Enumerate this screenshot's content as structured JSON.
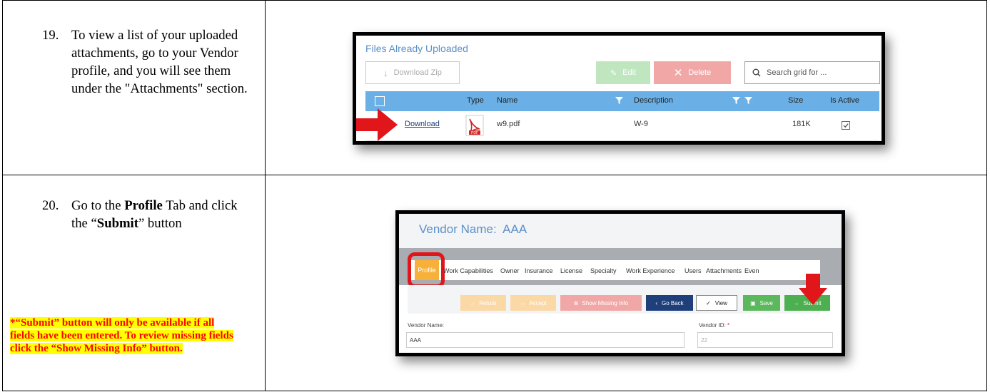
{
  "steps": [
    {
      "number": "19.",
      "text": "To view a list of your uploaded attachments, go to your Vendor profile, and you will see them under the \"Attachments\" section."
    },
    {
      "number": "20.",
      "pre": "Go to the ",
      "bold1": "Profile",
      "mid": " Tab and click the “",
      "bold2": "Submit",
      "post": "” button",
      "note": "*“Submit” button will only be available if all fields have been entered. To review missing fields click the “Show Missing Info” button."
    }
  ],
  "files_panel": {
    "title": "Files Already Uploaded",
    "download_zip": "Download Zip",
    "edit": "Edit",
    "delete": "Delete",
    "search_placeholder": "Search grid for ...",
    "columns": [
      "Type",
      "Name",
      "Description",
      "Size",
      "Is Active"
    ],
    "row": {
      "link": "Download",
      "name": "w9.pdf",
      "description": "W-9",
      "size": "181K",
      "pdf_label": "PDF"
    }
  },
  "vendor_panel": {
    "title": "Vendor Name:  AAA",
    "tabs": [
      "Profile",
      "Work Capabilities",
      "Owner",
      "Insurance",
      "License",
      "Specialty",
      "Work Experience",
      "Users",
      "Attachments",
      "Even"
    ],
    "buttons": {
      "return": "Return",
      "accept": "Accept",
      "show_missing": "Show Missing Info",
      "go_back": "Go Back",
      "view": "View",
      "save": "Save",
      "submit": "Submit"
    },
    "field_vendor_name_label": "Vendor Name:",
    "field_vendor_name_value": "AAA",
    "field_vendor_id_label": "Vendor ID:",
    "field_vendor_id_required": "*",
    "field_vendor_id_value": "22"
  },
  "colors": {
    "accent_blue": "#5b8fc9",
    "grid_header": "#6ab0e6",
    "submit_green": "#4caf50",
    "go_back_navy": "#1f3f7a",
    "profile_tab": "#f7b13a",
    "highlight_red": "#e0161b"
  }
}
